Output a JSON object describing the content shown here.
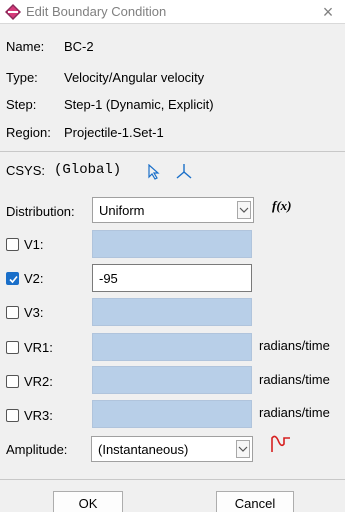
{
  "window": {
    "title": "Edit Boundary Condition",
    "close_glyph": "×"
  },
  "info": {
    "name_label": "Name:",
    "name_value": "BC-2",
    "type_label": "Type:",
    "type_value": "Velocity/Angular velocity",
    "step_label": "Step:",
    "step_value": "Step-1 (Dynamic, Explicit)",
    "region_label": "Region:",
    "region_value": "Projectile-1.Set-1"
  },
  "csys": {
    "label": "CSYS:",
    "value": "(Global)",
    "select_icon": "arrow-cursor-icon",
    "axis_icon": "csys-axes-icon"
  },
  "distribution": {
    "label": "Distribution:",
    "value": "Uniform",
    "function_label": "f(x)"
  },
  "components": [
    {
      "label": "V1:",
      "checked": false,
      "value": "",
      "units": ""
    },
    {
      "label": "V2:",
      "checked": true,
      "value": "-95",
      "units": ""
    },
    {
      "label": "V3:",
      "checked": false,
      "value": "",
      "units": ""
    },
    {
      "label": "VR1:",
      "checked": false,
      "value": "",
      "units": "radians/time"
    },
    {
      "label": "VR2:",
      "checked": false,
      "value": "",
      "units": "radians/time"
    },
    {
      "label": "VR3:",
      "checked": false,
      "value": "",
      "units": "radians/time"
    }
  ],
  "amplitude": {
    "label": "Amplitude:",
    "value": "(Instantaneous)",
    "icon": "amplitude-icon"
  },
  "buttons": {
    "ok": "OK",
    "cancel": "Cancel"
  },
  "colors": {
    "disabled_field": "#b8cfe8",
    "checkbox_checked": "#1a6fc9",
    "amplitude_icon": "#d62020"
  }
}
